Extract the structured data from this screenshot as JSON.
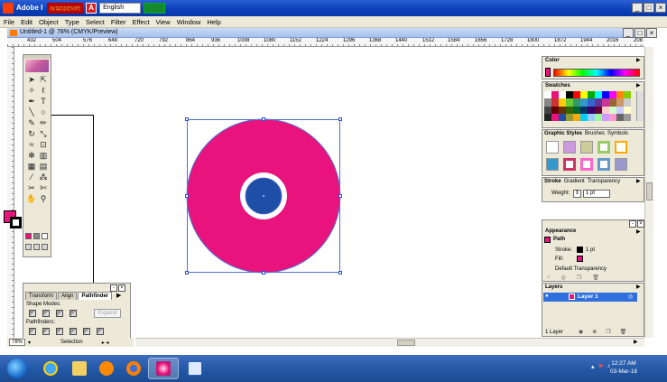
{
  "app": {
    "title": "Adobe I",
    "ime_label": "আমারবাংলা",
    "ime_language": "English"
  },
  "menu": [
    "File",
    "Edit",
    "Object",
    "Type",
    "Select",
    "Filter",
    "Effect",
    "View",
    "Window",
    "Help"
  ],
  "document": {
    "title": "Untitled-1 @ 78% (CMYK/Preview)",
    "zoom": "78%",
    "status_mode": "Selection"
  },
  "ruler": {
    "ticks": [
      "432",
      "504",
      "576",
      "648",
      "720",
      "792",
      "864",
      "936",
      "1008",
      "1080",
      "1152",
      "1224",
      "1296",
      "1368",
      "1440",
      "1512",
      "1584",
      "1656",
      "1728",
      "1800",
      "1872",
      "1944",
      "2016",
      "208"
    ]
  },
  "pathfinder": {
    "tabs": [
      "Transform",
      "Align",
      "Pathfinder"
    ],
    "shape_modes_label": "Shape Modes:",
    "pathfinders_label": "Pathfinders:",
    "expand_label": "Expand"
  },
  "color_panel": {
    "title": "Color"
  },
  "swatches_panel": {
    "title": "Swatches"
  },
  "styles_panel": {
    "tabs": [
      "Graphic Styles",
      "Brushes",
      "Symbols"
    ]
  },
  "stroke_panel": {
    "tabs": [
      "Stroke",
      "Gradient",
      "Transparency"
    ],
    "weight_label": "Weight:",
    "weight_value": "1 pt"
  },
  "appearance_panel": {
    "title": "Appearance",
    "item": "Path",
    "stroke_label": "Stroke:",
    "stroke_value": "1 pt",
    "fill_label": "Fill:",
    "transparency": "Default Transparency"
  },
  "layers_panel": {
    "title": "Layers",
    "layer_name": "Layer 1",
    "count": "1 Layer"
  },
  "artwork": {
    "outer_color": "#e8137c",
    "ring_color": "#ffffff",
    "inner_color": "#1f4ea6",
    "selection_color": "#4f6fd6"
  },
  "taskbar": {
    "time": "12:27 AM",
    "date": "03-Mar-18"
  },
  "colors": {
    "accent_pink": "#e8137c",
    "title_blue": "#0a3fb8"
  }
}
